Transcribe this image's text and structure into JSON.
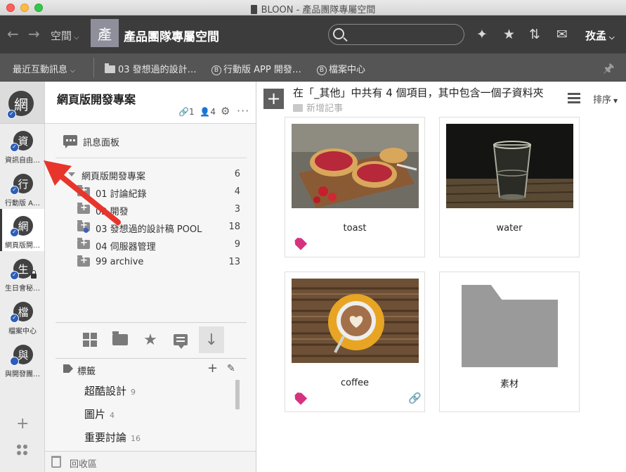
{
  "window": {
    "app_title": "BLOON - 產品團隊專屬空間"
  },
  "toolbar": {
    "space_menu_label": "空間",
    "space_avatar_char": "產",
    "space_title": "產品團隊專屬空間",
    "search_placeholder": "",
    "user_name": "孜孟"
  },
  "breadcrumbs": {
    "recent_label": "最近互動訊息",
    "items": [
      {
        "label": "03 發想過的設計…",
        "icon": "folder-icon"
      },
      {
        "label": "行動版 APP 開發…",
        "icon": "b-circle-icon",
        "badge": "B"
      },
      {
        "label": "檔案中心",
        "icon": "b-circle-icon",
        "badge": "B"
      }
    ]
  },
  "rail": {
    "top_avatar": "網",
    "workspaces": [
      {
        "char": "資",
        "label": "資訊自由…",
        "checked": true,
        "locked": false,
        "active": false
      },
      {
        "char": "行",
        "label": "行動版 A…",
        "checked": true,
        "locked": false,
        "active": false
      },
      {
        "char": "網",
        "label": "網頁版開…",
        "checked": true,
        "locked": false,
        "active": true
      },
      {
        "char": "生",
        "label": "生日會秘…",
        "checked": true,
        "locked": true,
        "active": false
      },
      {
        "char": "檔",
        "label": "檔案中心",
        "checked": true,
        "locked": false,
        "active": false
      },
      {
        "char": "與",
        "label": "與開發團…",
        "checked": false,
        "locked": false,
        "active": false
      }
    ]
  },
  "panel": {
    "title": "網頁版開發專案",
    "link_count": "1",
    "member_count": "4",
    "message_board_label": "訊息面板",
    "tree": [
      {
        "name": "網頁版開發專案",
        "count": "6",
        "level": 0
      },
      {
        "name": "01 討論紀錄",
        "count": "4",
        "level": 1
      },
      {
        "name": "02 開發",
        "count": "3",
        "level": 1
      },
      {
        "name": "03 發想過的設計稿 POOL",
        "count": "18",
        "level": 1,
        "shared": true
      },
      {
        "name": "04 伺服器管理",
        "count": "9",
        "level": 1
      },
      {
        "name": "99 archive",
        "count": "13",
        "level": 1
      }
    ],
    "tags_label": "標籤",
    "tags": [
      {
        "name": "超酷設計",
        "count": "9"
      },
      {
        "name": "圖片",
        "count": "4"
      },
      {
        "name": "重要討論",
        "count": "16"
      }
    ],
    "trash_label": "回收區"
  },
  "content": {
    "title": "在「_其他」中共有 4 個項目，其中包含一個子資料夾",
    "new_note_label": "新增記事",
    "sort_label": "排序",
    "cards": [
      {
        "caption": "toast",
        "has_tag": true,
        "has_link": false
      },
      {
        "caption": "water",
        "has_tag": false,
        "has_link": false
      },
      {
        "caption": "coffee",
        "has_tag": true,
        "has_link": true
      },
      {
        "caption": "素材",
        "has_tag": false,
        "has_link": false
      }
    ]
  },
  "colors": {
    "toolbar_bg": "#3c3c3c",
    "crumbbar_bg": "#555555",
    "check_badge": "#2d5db8",
    "tag_pink": "#d6337f",
    "link_green": "#59a13a",
    "annotation_red": "#e8352b"
  }
}
